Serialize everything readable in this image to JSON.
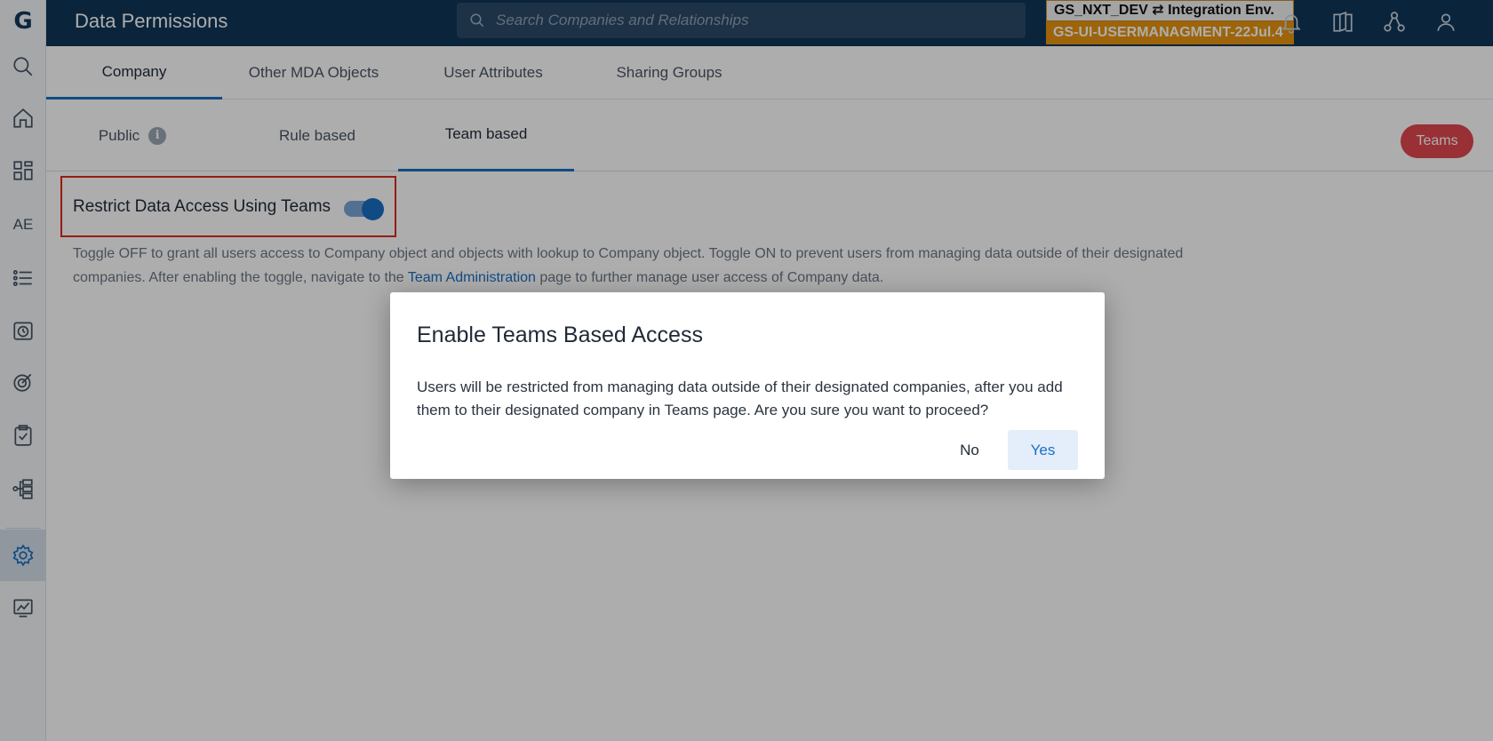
{
  "app": {
    "logo_letter": "G",
    "page_title": "Data Permissions"
  },
  "search": {
    "placeholder": "Search Companies and Relationships"
  },
  "environment": {
    "line1": "GS_NXT_DEV ⇄ Integration Env.",
    "line2": "GS-UI-USERMANAGMENT-22Jul.4"
  },
  "sidebar": {
    "items": [
      {
        "icon": "search-icon"
      },
      {
        "icon": "home-icon"
      },
      {
        "icon": "dashboard-icon"
      },
      {
        "icon": "ae-icon",
        "label": "AE"
      },
      {
        "icon": "list-icon"
      },
      {
        "icon": "timeline-icon"
      },
      {
        "icon": "target-icon"
      },
      {
        "icon": "checklist-icon"
      },
      {
        "icon": "hierarchy-icon"
      },
      {
        "icon": "gear-icon",
        "active": true
      },
      {
        "icon": "analytics-icon"
      }
    ]
  },
  "header_icons": [
    "bell-icon",
    "book-icon",
    "network-icon",
    "user-icon"
  ],
  "primary_tabs": [
    {
      "label": "Company",
      "active": true
    },
    {
      "label": "Other MDA Objects"
    },
    {
      "label": "User Attributes"
    },
    {
      "label": "Sharing Groups"
    }
  ],
  "secondary_tabs": [
    {
      "label": "Public",
      "has_info": true
    },
    {
      "label": "Rule based"
    },
    {
      "label": "Team based",
      "active": true
    }
  ],
  "teams_button": "Teams",
  "restrict": {
    "label": "Restrict Data Access Using Teams",
    "toggle_on": true
  },
  "help": {
    "text_before": "Toggle OFF to grant all users access to Company object and objects with lookup to Company object. Toggle ON to prevent users from managing data outside of their designated companies. After enabling the toggle, navigate to the ",
    "link": "Team Administration",
    "text_after": " page to further manage user access of Company data."
  },
  "dialog": {
    "title": "Enable Teams Based Access",
    "body": "Users will be restricted from managing data outside of their designated companies, after you add them to their designated company in Teams page. Are you sure you want to proceed?",
    "no_label": "No",
    "yes_label": "Yes"
  },
  "colors": {
    "topbar": "#0f3558",
    "accent": "#1a6fc4",
    "teams_button": "#e0484f",
    "env_badge": "#e8940e",
    "highlight_border": "#e0281c"
  }
}
